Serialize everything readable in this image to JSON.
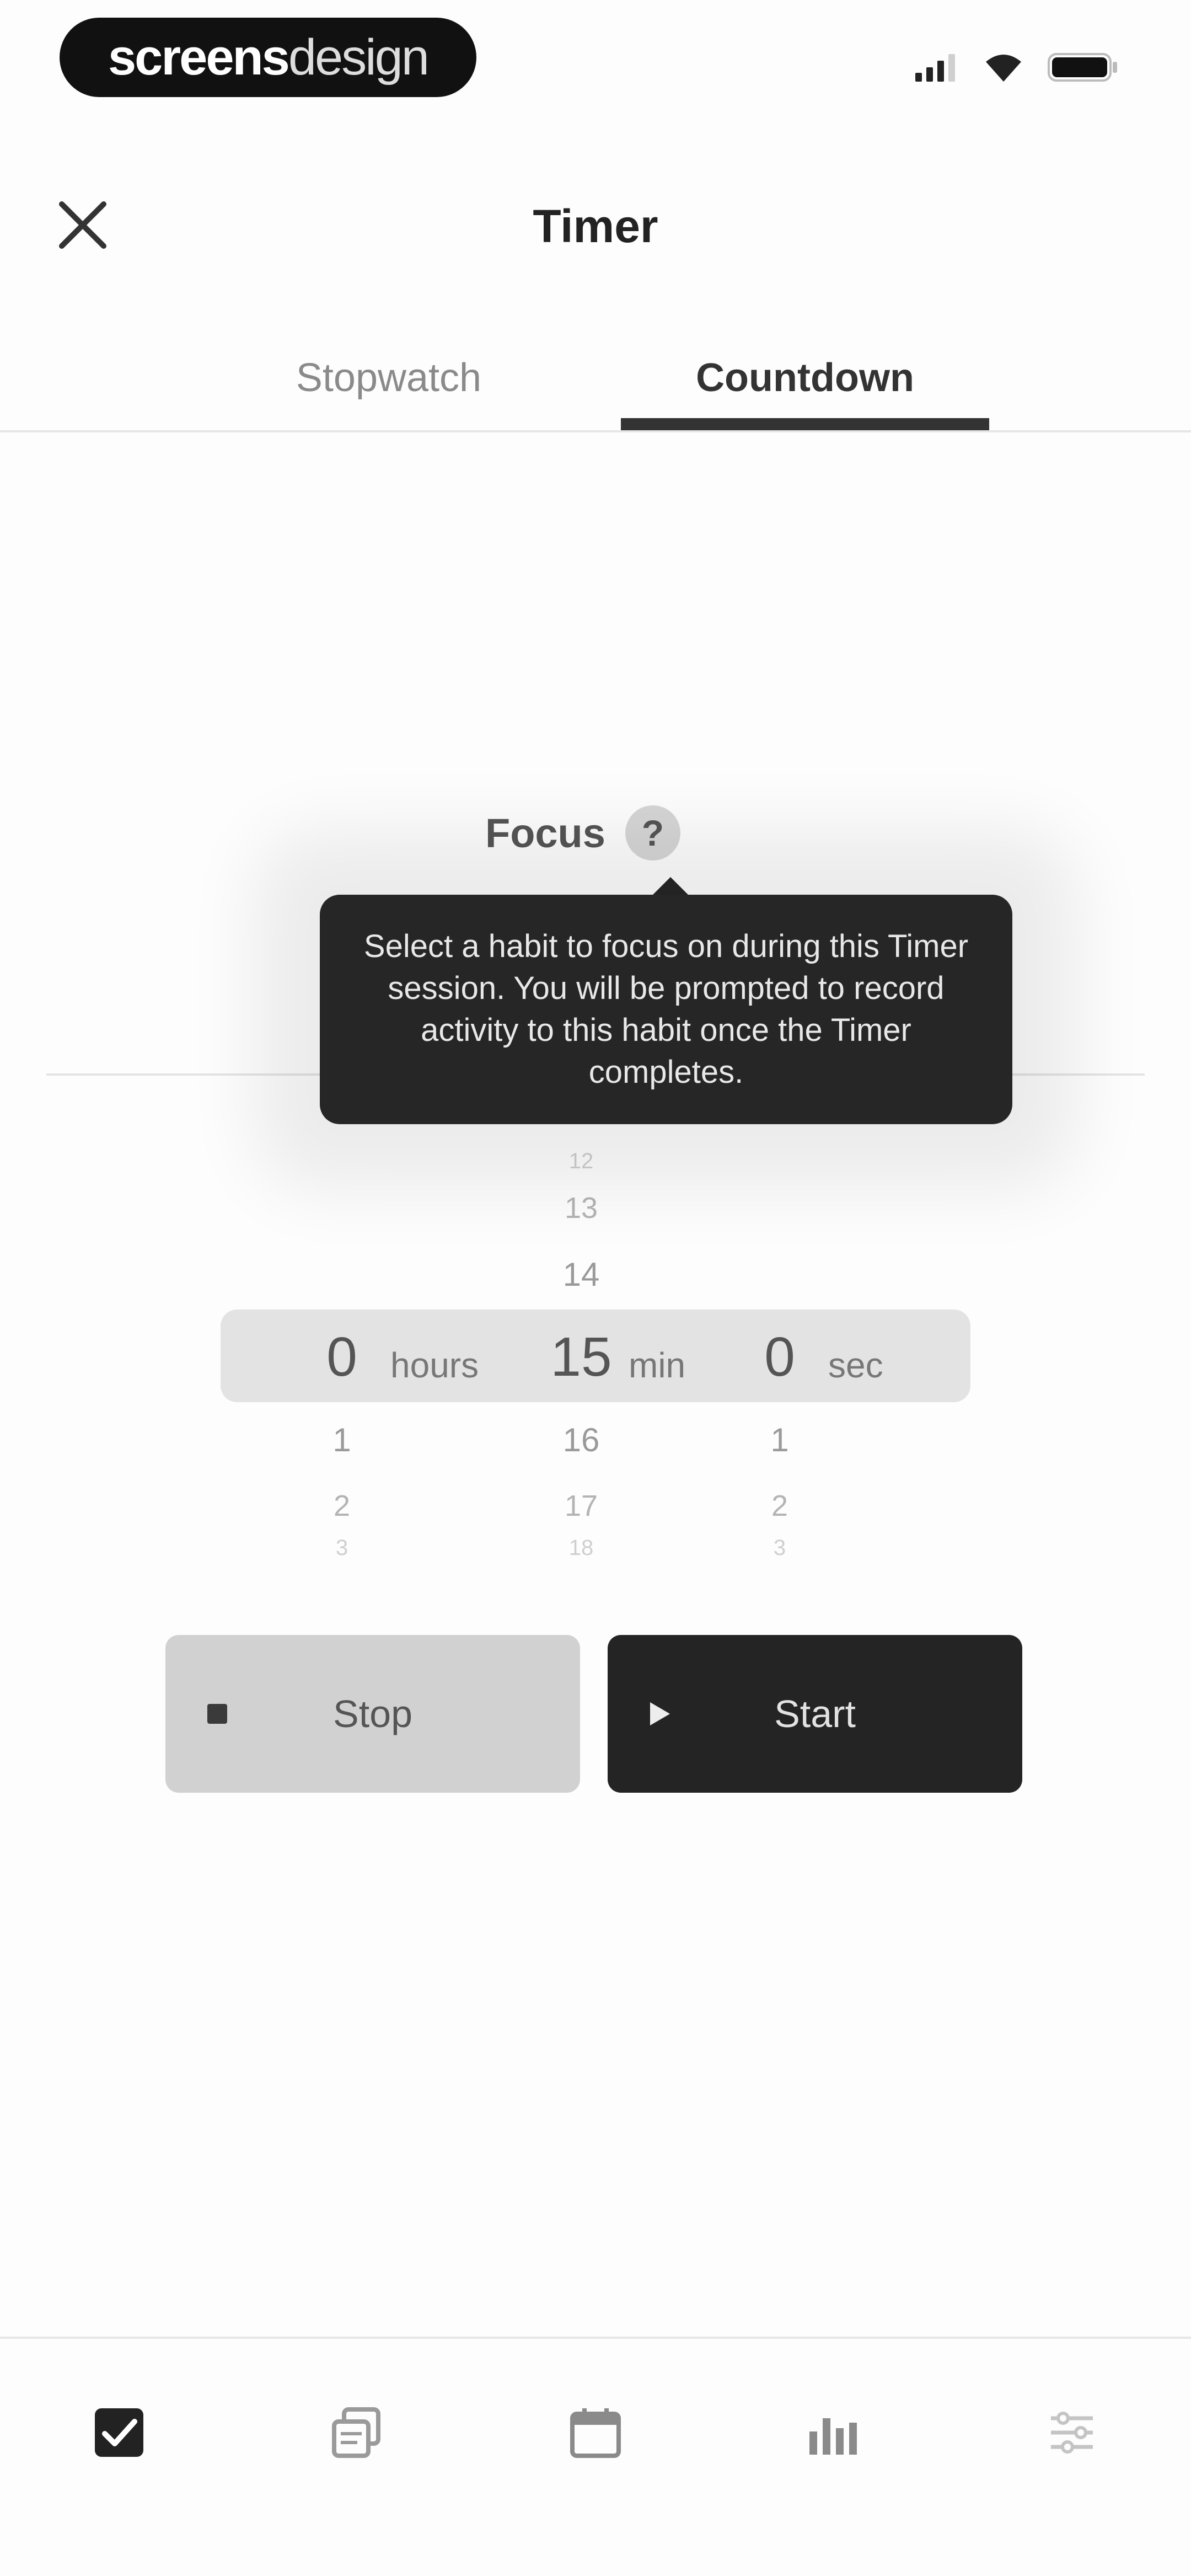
{
  "status_bar": {
    "brand_bold": "screens",
    "brand_light": "design",
    "icons": [
      "cellular-signal-icon",
      "wifi-icon",
      "battery-icon"
    ]
  },
  "header": {
    "close_icon": "close-icon",
    "title": "Timer"
  },
  "tabs": [
    {
      "label": "Stopwatch",
      "selected": false
    },
    {
      "label": "Countdown",
      "selected": true
    }
  ],
  "focus": {
    "label": "Focus",
    "help_glyph": "?"
  },
  "tooltip": {
    "text": "Select a habit to focus on during this Timer session. You will be prompted to record activity to this habit once the Timer completes."
  },
  "picker": {
    "hours": {
      "above": [
        "",
        "",
        ""
      ],
      "selected": "0",
      "below": [
        "1",
        "2",
        "3"
      ],
      "unit": "hours"
    },
    "minutes": {
      "above": [
        "12",
        "13",
        "14"
      ],
      "selected": "15",
      "below": [
        "16",
        "17",
        "18"
      ],
      "unit": "min"
    },
    "seconds": {
      "above": [
        "",
        "",
        ""
      ],
      "selected": "0",
      "below": [
        "1",
        "2",
        "3"
      ],
      "unit": "sec"
    }
  },
  "actions": {
    "stop_label": "Stop",
    "start_label": "Start"
  },
  "bottom_nav": [
    {
      "icon": "checkbox-checked-icon",
      "active": true
    },
    {
      "icon": "stacked-cards-icon",
      "active": false
    },
    {
      "icon": "calendar-icon",
      "active": false
    },
    {
      "icon": "bar-chart-icon",
      "active": false
    },
    {
      "icon": "settings-sliders-icon",
      "active": false
    }
  ],
  "colors": {
    "primary_dark": "#242424",
    "secondary_gray": "#d1d1d1",
    "picker_highlight": "#e3e3e3",
    "tooltip_bg": "#262626"
  }
}
